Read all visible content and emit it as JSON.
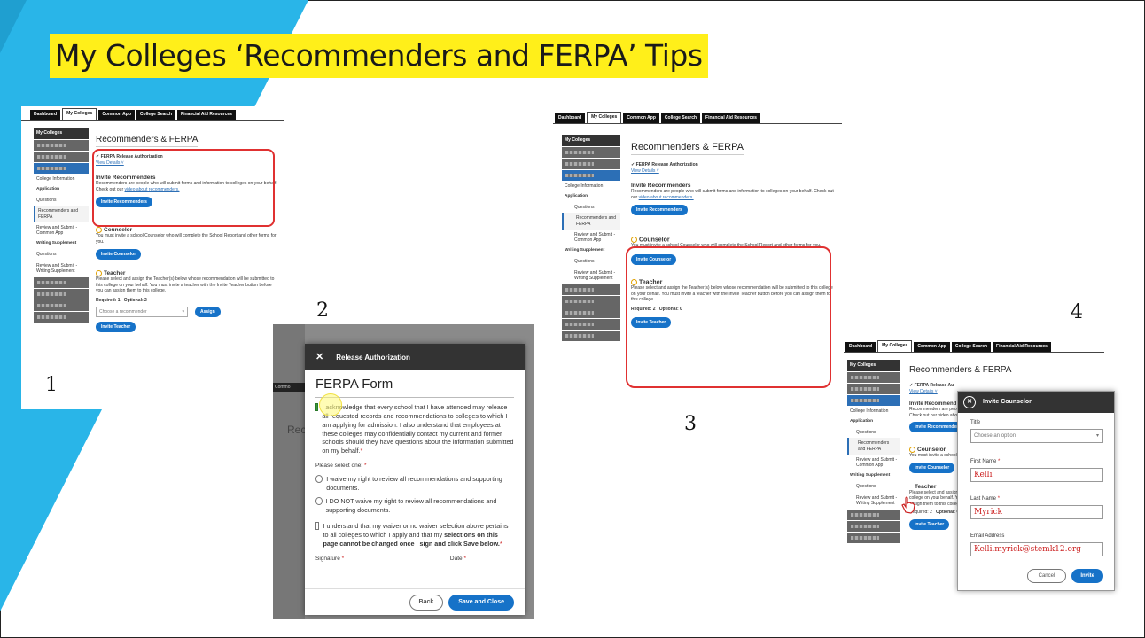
{
  "slide": {
    "title": "My Colleges ‘Recommenders and FERPA’ Tips",
    "numbers": [
      "1",
      "2",
      "3",
      "4"
    ],
    "accent_color": "#29b5e8",
    "highlight_color": "#ffef1a"
  },
  "portal": {
    "tabs": [
      "Dashboard",
      "My Colleges",
      "Common App",
      "College Search",
      "Financial Aid Resources"
    ],
    "sidebar": {
      "header": "My Colleges",
      "links": [
        "College Information",
        "Application",
        "Questions",
        "Recommenders and FERPA",
        "Review and Submit - Common App",
        "Writing Supplement",
        "Questions",
        "Review and Submit - Writing Supplement"
      ]
    },
    "page_title": "Recommenders & FERPA",
    "ferpa": {
      "label": "✓ FERPA Release Authorization",
      "link": "View Details ˅"
    },
    "invite": {
      "heading": "Invite Recommenders",
      "text": "Recommenders are people who will submit forms and information to colleges on your behalf. Check out our",
      "link": "video about recommenders.",
      "button": "Invite Recommenders"
    },
    "counselor": {
      "heading": "Counselor",
      "text": "You must invite a school Counselor who will complete the School Report and other forms for you.",
      "button": "Invite Counselor"
    },
    "teacher": {
      "heading": "Teacher",
      "text": "Please select and assign the Teacher(s) below whose recommendation will be submitted to this college on your behalf. You must invite a teacher with the Invite Teacher button before you can assign them to this college.",
      "required": "Required: 1",
      "required3": "Required: 2",
      "optional": "Optional: 2",
      "optional3": "Optional: 0",
      "select_placeholder": "Choose a recommender",
      "assign": "Assign",
      "button": "Invite Teacher"
    }
  },
  "ferpa_modal": {
    "header": "Release Authorization",
    "title": "FERPA Form",
    "ack": "I acknowledge that every school that I have attended may release all requested records and recommendations to colleges to which I am applying for admission. I also understand that employees at these colleges may confidentially contact my current and former schools should they have questions about the information submitted on my behalf.",
    "select_one": "Please select one:",
    "waive": "I waive my right to review all recommendations and supporting documents.",
    "not_waive": "I DO NOT waive my right to review all recommendations and supporting documents.",
    "understand_a": "I understand that my waiver or no waiver selection above pertains to all colleges to which I apply and that my",
    "understand_b": "selections on this page cannot be changed once I sign and click Save below.",
    "signature": "Signature",
    "date": "Date",
    "back": "Back",
    "save": "Save and Close",
    "bg_tab": "Commo",
    "bg_title": "Rec",
    "bg_lines": [
      "FE",
      "Before",
      "compl"
    ],
    "bg_learn": "Learn"
  },
  "invite_modal": {
    "header": "Invite Counselor",
    "title_label": "Title",
    "title_placeholder": "Choose an option",
    "first_label": "First Name",
    "first_value": "Kelli",
    "last_label": "Last Name",
    "last_value": "Myrick",
    "email_label": "Email Address",
    "email_value": "Kelli.myrick@stemk12.org",
    "cancel": "Cancel",
    "invite": "Invite"
  },
  "partial4": {
    "ferpa": "✓ FERPA Release Au",
    "view": "View Details ˅",
    "invite_head": "Invite Recommend",
    "invite_text": "Recommenders are peopl",
    "invite_text2": "Check out our video about",
    "counselor_text": "You must invite a school C",
    "teacher_text": "Please select and assign t",
    "teacher_text2": "college on your behalf. Yo",
    "teacher_text3": "assign them to this colleg",
    "req": "Required: 2",
    "opt": "Optional: C"
  }
}
